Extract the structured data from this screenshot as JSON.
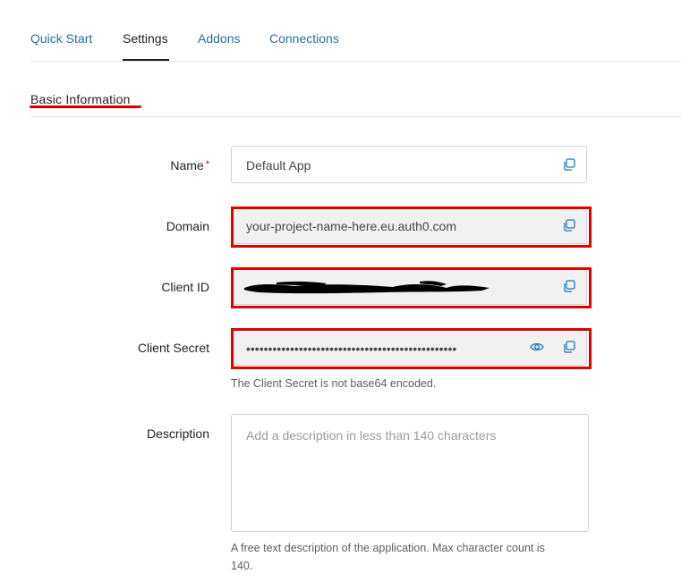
{
  "tabs": [
    {
      "label": "Quick Start"
    },
    {
      "label": "Settings"
    },
    {
      "label": "Addons"
    },
    {
      "label": "Connections"
    }
  ],
  "section": {
    "title": "Basic Information"
  },
  "fields": {
    "name": {
      "label": "Name",
      "required_mark": "*",
      "value": "Default App"
    },
    "domain": {
      "label": "Domain",
      "value": "your-project-name-here.eu.auth0.com"
    },
    "client_id": {
      "label": "Client ID",
      "value": ""
    },
    "client_secret": {
      "label": "Client Secret",
      "value": "••••••••••••••••••••••••••••••••••••••••••••••••",
      "help": "The Client Secret is not base64 encoded."
    },
    "description": {
      "label": "Description",
      "placeholder": "Add a description in less than 140 characters",
      "help_line1": "A free text description of the application. Max character count is",
      "help_line2": "140."
    }
  },
  "colors": {
    "link": "#2b6f9b",
    "highlight": "#e00000",
    "icon": "#1f7bb6"
  },
  "icons": [
    "copy-icon",
    "eye-icon"
  ]
}
